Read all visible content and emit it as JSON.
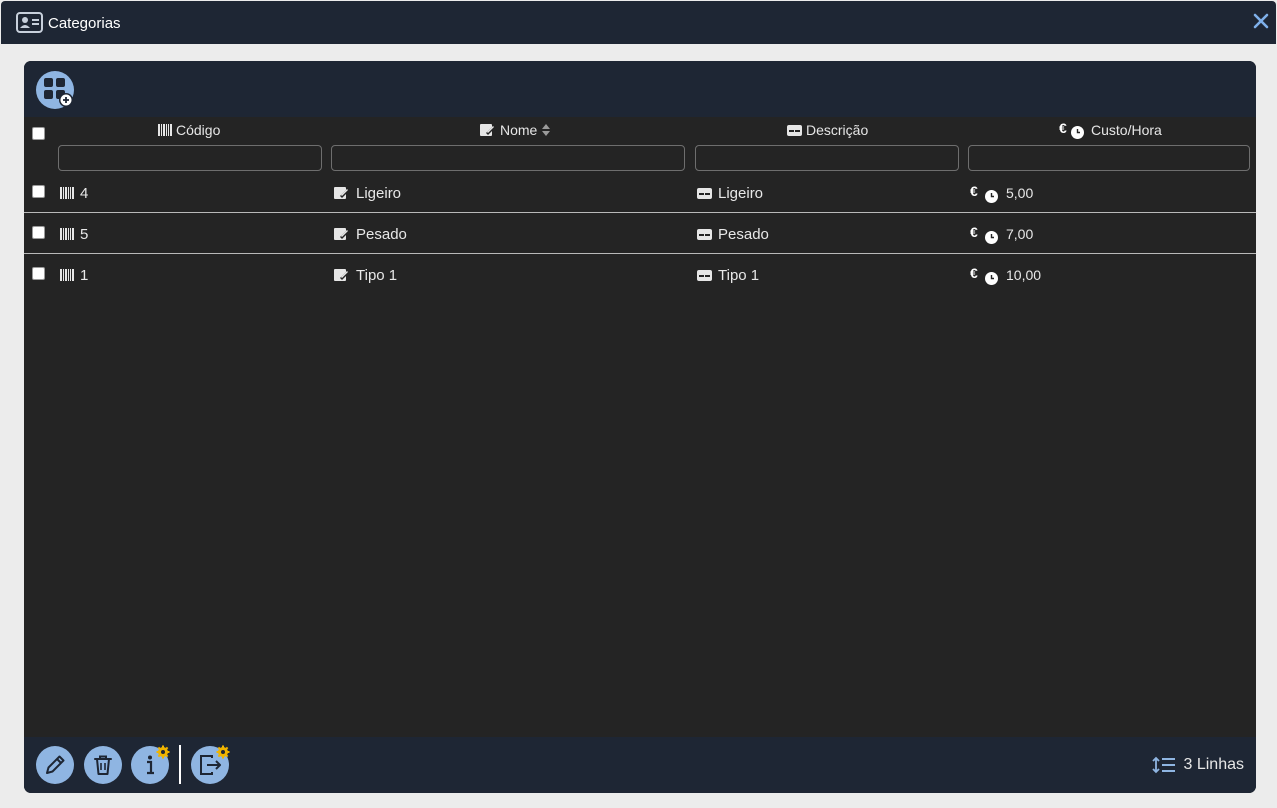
{
  "window": {
    "title": "Categorias",
    "icon": "contact-card-icon",
    "close_icon": "close-icon"
  },
  "colors": {
    "titlebar_bg": "#1e2634",
    "panel_bg": "#242424",
    "button_bg": "#8fb5e2",
    "badge_color": "#f0b400",
    "text": "#e8e8e8"
  },
  "toolbar": {
    "add_button_icon": "grid-add-icon"
  },
  "table": {
    "columns": [
      {
        "label": "Código",
        "icon": "barcode-icon"
      },
      {
        "label": "Nome",
        "icon": "signature-icon",
        "sort": "sort-icon"
      },
      {
        "label": "Descrição",
        "icon": "card-icon"
      },
      {
        "label": "Custo/Hora",
        "icon": "euro-clock-icon"
      }
    ],
    "rows": [
      {
        "codigo": "4",
        "nome": "Ligeiro",
        "descricao": "Ligeiro",
        "custo": "5,00"
      },
      {
        "codigo": "5",
        "nome": "Pesado",
        "descricao": "Pesado",
        "custo": "7,00"
      },
      {
        "codigo": "1",
        "nome": "Tipo 1",
        "descricao": "Tipo 1",
        "custo": "10,00"
      }
    ]
  },
  "footer": {
    "buttons": [
      "edit-icon",
      "trash-icon",
      "info-icon",
      "export-icon"
    ],
    "rows_count": "3 Linhas",
    "rows_icon": "line-height-icon"
  }
}
